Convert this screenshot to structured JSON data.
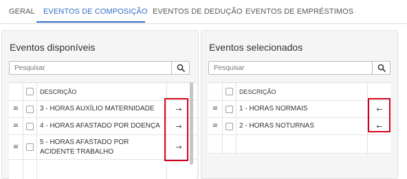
{
  "tabs": [
    {
      "label": "GERAL"
    },
    {
      "label": "EVENTOS DE COMPOSIÇÃO"
    },
    {
      "label": "EVENTOS DE DEDUÇÃO"
    },
    {
      "label": "EVENTOS DE EMPRÉSTIMOS"
    }
  ],
  "left_panel": {
    "title": "Eventos disponíveis",
    "search_placeholder": "Pesquisar",
    "header": "DESCRIÇÃO",
    "rows": [
      {
        "description": "3 - HORAS AUXÍLIO MATERNIDADE",
        "action": "→"
      },
      {
        "description": "4 - HORAS AFASTADO POR DOENÇA",
        "action": "→"
      },
      {
        "description": "5 - HORAS AFASTADO POR ACIDENTE TRABALHO",
        "action": "→"
      }
    ]
  },
  "right_panel": {
    "title": "Eventos selecionados",
    "search_placeholder": "Pesquisar",
    "header": "DESCRIÇÃO",
    "rows": [
      {
        "description": "1 - HORAS NORMAIS",
        "action": "←"
      },
      {
        "description": "2 - HORAS NOTURNAS",
        "action": "←"
      }
    ]
  },
  "icons": {
    "drag_handle": "≡",
    "search": "search-icon"
  },
  "colors": {
    "accent": "#2f6fc6",
    "highlight": "#d0021b"
  }
}
